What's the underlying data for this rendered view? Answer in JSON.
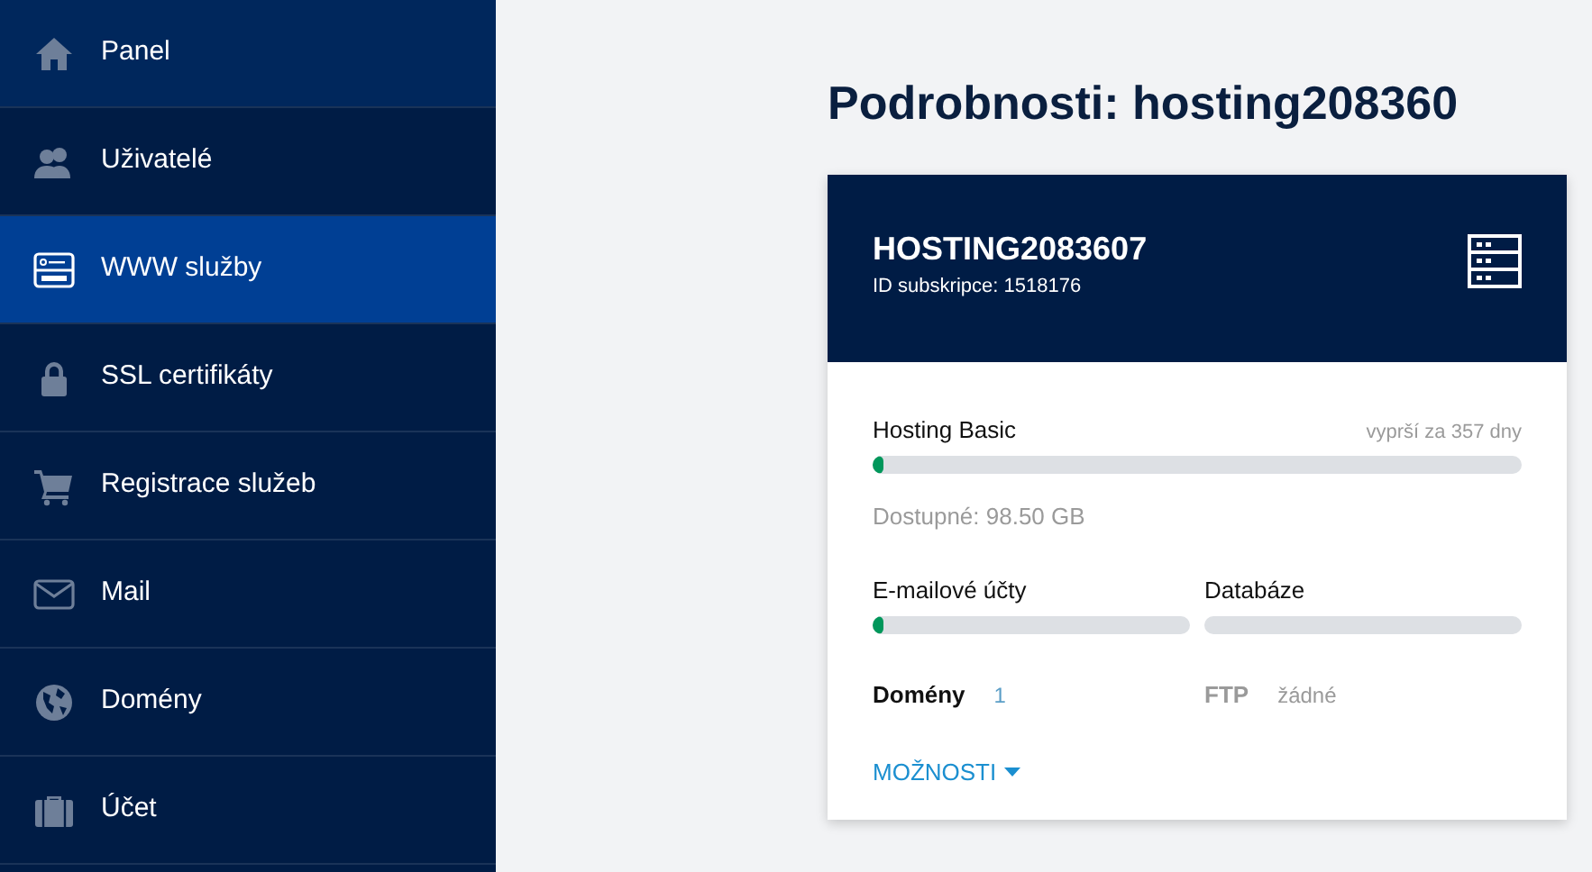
{
  "sidebar": {
    "items": [
      {
        "label": "Panel",
        "selected": false,
        "highlighted": true
      },
      {
        "label": "Uživatelé",
        "selected": false,
        "highlighted": false
      },
      {
        "label": "WWW služby",
        "selected": true,
        "highlighted": false
      },
      {
        "label": "SSL certifikáty",
        "selected": false,
        "highlighted": false
      },
      {
        "label": "Registrace služeb",
        "selected": false,
        "highlighted": false
      },
      {
        "label": "Mail",
        "selected": false,
        "highlighted": false
      },
      {
        "label": "Domény",
        "selected": false,
        "highlighted": false
      },
      {
        "label": "Účet",
        "selected": false,
        "highlighted": false
      }
    ]
  },
  "page_title": "Podrobnosti: hosting208360",
  "card": {
    "name": "HOSTING2083607",
    "subtitle": "ID subskripce: 1518176",
    "plan": {
      "label": "Hosting Basic",
      "expiry": "vyprší za 357 dny",
      "level": 0.01,
      "available": "Dostupné: 98.50 GB"
    },
    "meters": [
      {
        "label": "E-mailové účty",
        "level": 0.005
      },
      {
        "label": "Databáze",
        "level": 0
      }
    ],
    "stats": [
      {
        "label": "Domény",
        "value": "1",
        "disabled": false
      },
      {
        "label": "FTP",
        "value": "žádné",
        "disabled": true
      }
    ],
    "options": "MOŽNOSTI"
  }
}
